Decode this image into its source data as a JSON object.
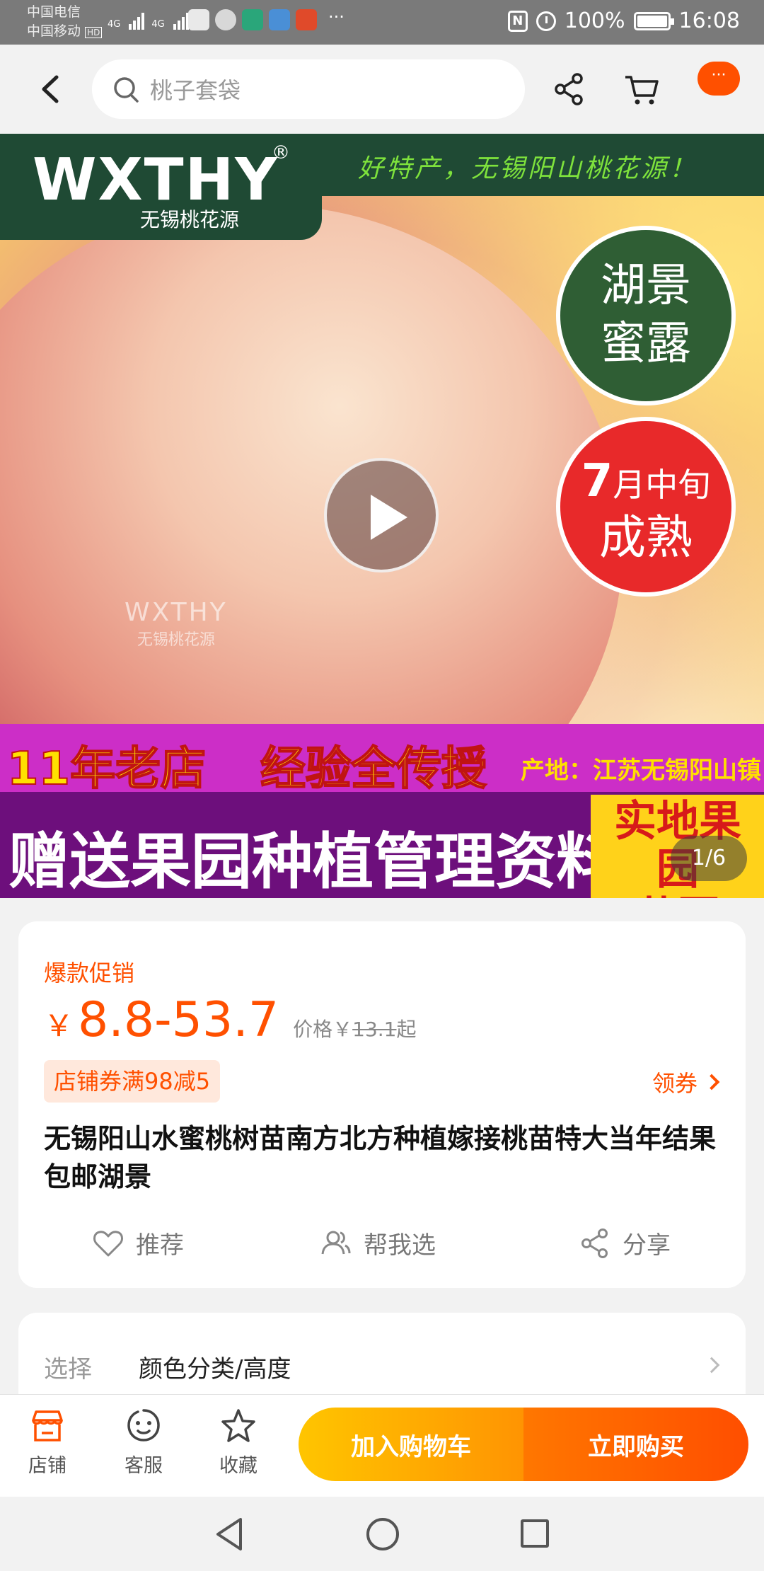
{
  "status_bar": {
    "carrier1": "中国电信",
    "carrier2": "中国移动",
    "hd": "HD",
    "net1": "4G",
    "net2": "4G",
    "more": "···",
    "nfc": "N",
    "battery": "100%",
    "time": "16:08"
  },
  "header": {
    "search_placeholder": "桃子套袋",
    "more_label": "···"
  },
  "hero": {
    "brand_logo": "WXTHY",
    "brand_reg": "®",
    "brand_sub": "无锡桃花源",
    "slogan": "好特产，无锡阳山桃花源！",
    "badge_green_l1": "湖景",
    "badge_green_l2": "蜜露",
    "badge_red_num": "7",
    "badge_red_l1": "月中旬",
    "badge_red_l2": "成熟",
    "watermark_l1": "WXTHY",
    "watermark_l2": "无锡桃花源",
    "band1_t1": "11年老店",
    "band1_t2": "经验全传授",
    "band1_t3": "产地：江苏无锡阳山镇",
    "band2_t1": "赠送果园种植管理资料",
    "band2_t2_l1": "实地果园",
    "band2_t2_l2": "苗圃",
    "page_indicator": "1/6"
  },
  "product": {
    "promo_tag": "爆款促销",
    "currency": "￥",
    "price_range": "8.8-53.7",
    "orig_prefix": "价格￥",
    "orig_price": "13.1",
    "orig_suffix": "起",
    "coupon": "店铺券满98减5",
    "get_coupon": "领券",
    "title": "无锡阳山水蜜桃树苗南方北方种植嫁接桃苗特大当年结果包邮湖景",
    "actions": {
      "recommend": "推荐",
      "help_choose": "帮我选",
      "share": "分享"
    }
  },
  "select": {
    "label": "选择",
    "value": "颜色分类/高度"
  },
  "bottom": {
    "store": "店铺",
    "service": "客服",
    "favorite": "收藏",
    "add_cart": "加入购物车",
    "buy_now": "立即购买"
  },
  "colors": {
    "accent": "#ff5000",
    "cart_button": "#ffb000",
    "buy_button": "#ff5a00"
  }
}
